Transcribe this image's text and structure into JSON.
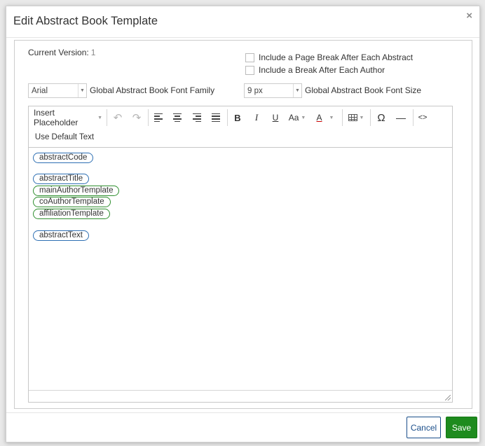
{
  "dialog": {
    "title": "Edit Abstract Book Template",
    "close_glyph": "×"
  },
  "version": {
    "label": "Current Version:",
    "value": "1"
  },
  "options": {
    "page_break_label": "Include a Page Break After Each Abstract",
    "author_break_label": "Include a Break After Each Author"
  },
  "font_family": {
    "selected": "Arial",
    "label": "Global Abstract Book Font Family"
  },
  "font_size": {
    "selected": "9 px",
    "label": "Global Abstract Book Font Size"
  },
  "toolbar": {
    "insert_placeholder": "Insert Placeholder",
    "undo": "↶",
    "redo": "↷",
    "bold": "B",
    "italic": "I",
    "underline": "U",
    "font_size": "Aa",
    "font_color": "A",
    "special_char": "Ω",
    "horizontal_rule": "—",
    "code_view": "<>",
    "use_default_text": "Use Default Text"
  },
  "placeholders": [
    {
      "text": "abstractCode",
      "color": "blue"
    },
    {
      "text": "abstractTitle",
      "color": "blue"
    },
    {
      "text": "mainAuthorTemplate",
      "color": "green"
    },
    {
      "text": "coAuthorTemplate",
      "color": "green"
    },
    {
      "text": "affiliationTemplate",
      "color": "green"
    },
    {
      "text": "abstractText",
      "color": "blue"
    }
  ],
  "footer": {
    "cancel_label": "Cancel",
    "save_label": "Save"
  },
  "colors": {
    "primary_blue": "#1a4e8a",
    "save_green": "#1e8b1e",
    "chip_blue": "#2e6fb3",
    "chip_green": "#2f8f2f"
  }
}
